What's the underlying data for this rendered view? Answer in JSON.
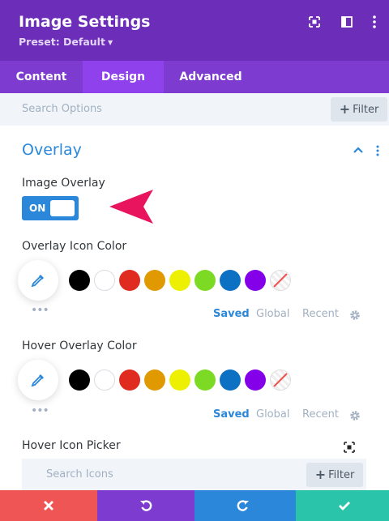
{
  "header": {
    "title": "Image Settings",
    "preset": "Preset: Default",
    "icons": [
      "expand-icon",
      "sidebar-icon",
      "more-vertical-icon"
    ]
  },
  "tabs": [
    {
      "label": "Content",
      "active": false
    },
    {
      "label": "Design",
      "active": true
    },
    {
      "label": "Advanced",
      "active": false
    }
  ],
  "search": {
    "placeholder": "Search Options",
    "filter_label": "Filter"
  },
  "section": {
    "title": "Overlay",
    "image_overlay": {
      "label": "Image Overlay",
      "toggle_text": "ON",
      "state": true
    },
    "overlay_icon_color": {
      "label": "Overlay Icon Color",
      "swatches": [
        "#000000",
        "#ffffff",
        "#e02b20",
        "#e09900",
        "#edf000",
        "#7cda24",
        "#0c71c3",
        "#8300e9"
      ],
      "tabs": [
        "Saved",
        "Global",
        "Recent"
      ],
      "active_tab": "Saved"
    },
    "hover_overlay_color": {
      "label": "Hover Overlay Color",
      "swatches": [
        "#000000",
        "#ffffff",
        "#e02b20",
        "#e09900",
        "#edf000",
        "#7cda24",
        "#0c71c3",
        "#8300e9"
      ],
      "tabs": [
        "Saved",
        "Global",
        "Recent"
      ],
      "active_tab": "Saved"
    },
    "hover_icon_picker": {
      "label": "Hover Icon Picker",
      "search_placeholder": "Search Icons",
      "filter_label": "Filter"
    }
  },
  "footer": {
    "buttons": [
      {
        "name": "cancel",
        "color": "#ef5555"
      },
      {
        "name": "undo",
        "color": "#7e3bd0"
      },
      {
        "name": "redo",
        "color": "#2b87da"
      },
      {
        "name": "save",
        "color": "#29c4a9"
      }
    ]
  },
  "colors": {
    "header": "#6c2eb9",
    "accent_blue": "#2b87da",
    "pointer_arrow": "#e8155e"
  }
}
